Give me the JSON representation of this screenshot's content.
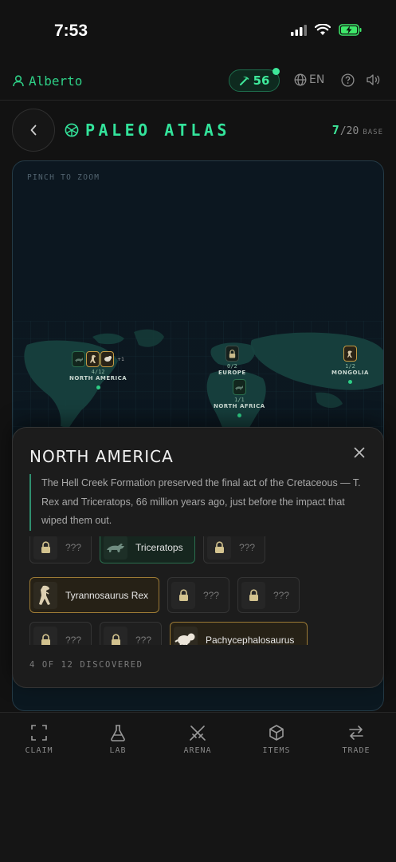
{
  "status_bar": {
    "time": "7:53"
  },
  "header": {
    "username": "Alberto",
    "points": "56",
    "language": "EN"
  },
  "title_row": {
    "title": "PALEO ATLAS",
    "progress_current": "7",
    "progress_total": "/20",
    "progress_label": "BASE"
  },
  "map": {
    "hint": "PINCH TO ZOOM",
    "regions": [
      {
        "name": "NORTH AMERICA",
        "count": "4/12",
        "extra": "+1"
      },
      {
        "name": "EUROPE",
        "count": "0/2"
      },
      {
        "name": "NORTH AFRICA",
        "count": "1/1"
      },
      {
        "name": "MONGOLIA",
        "count": "1/2"
      }
    ]
  },
  "sheet": {
    "title": "NORTH AMERICA",
    "description": "The Hell Creek Formation preserved the final act of the Cretaceous — T. Rex and Triceratops, 66 million years ago, just before the impact that wiped them out.",
    "slots": [
      {
        "label": "???",
        "state": "locked"
      },
      {
        "label": "Triceratops",
        "state": "found-green"
      },
      {
        "label": "???",
        "state": "locked"
      },
      {
        "label": "Tyrannosaurus Rex",
        "state": "found-gold"
      },
      {
        "label": "???",
        "state": "locked"
      },
      {
        "label": "???",
        "state": "locked"
      },
      {
        "label": "???",
        "state": "locked"
      },
      {
        "label": "???",
        "state": "locked"
      },
      {
        "label": "Pachycephalosaurus",
        "state": "found-gold"
      }
    ],
    "discovered": "4 OF 12 DISCOVERED"
  },
  "nav": {
    "items": [
      {
        "label": "CLAIM",
        "icon": "scan-icon"
      },
      {
        "label": "LAB",
        "icon": "flask-icon"
      },
      {
        "label": "ARENA",
        "icon": "swords-icon"
      },
      {
        "label": "ITEMS",
        "icon": "cube-icon"
      },
      {
        "label": "TRADE",
        "icon": "swap-arrows-icon"
      }
    ]
  },
  "colors": {
    "accent": "#33e39b",
    "gold": "#c49a43",
    "background": "#121212"
  }
}
